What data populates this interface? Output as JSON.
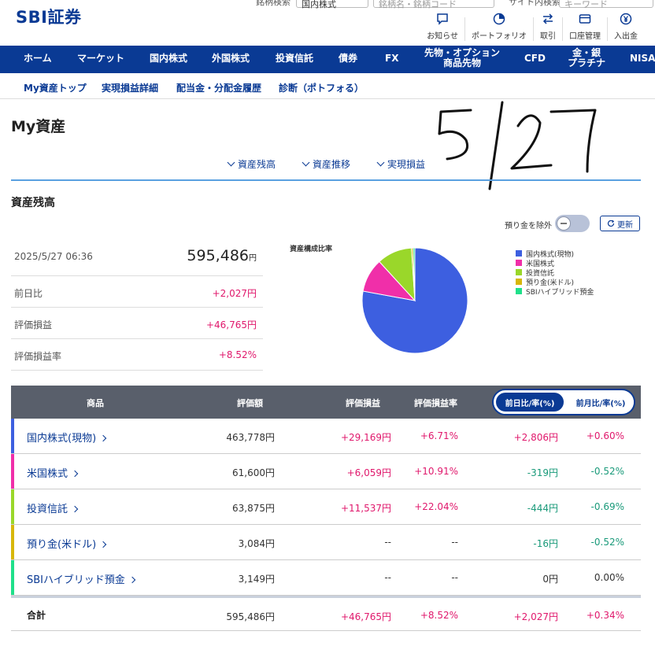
{
  "header": {
    "logo": "SBI証券",
    "search_label_1": "銘柄検索",
    "search_value_1": "国内株式",
    "search_placeholder_2": "銘柄名・銘柄コード",
    "search_label_2": "サイト内検索",
    "search_placeholder_3": "キーワード",
    "util": [
      {
        "label": "お知らせ",
        "icon": "chat-icon"
      },
      {
        "label": "ポートフォリオ",
        "icon": "portfolio-icon"
      },
      {
        "label": "取引",
        "icon": "transfer-icon"
      },
      {
        "label": "口座管理",
        "icon": "card-icon"
      },
      {
        "label": "入出金",
        "icon": "yen-icon"
      }
    ]
  },
  "gnav": [
    {
      "label": "ホーム"
    },
    {
      "label": "マーケット"
    },
    {
      "label": "国内株式"
    },
    {
      "label": "外国株式"
    },
    {
      "label": "投資信託"
    },
    {
      "label": "債券"
    },
    {
      "label": "FX"
    },
    {
      "label": "先物・オプション",
      "label2": "商品先物"
    },
    {
      "label": "CFD"
    },
    {
      "label": "金・銀",
      "label2": "プラチナ"
    },
    {
      "label": "NISA"
    }
  ],
  "subnav": [
    "My資産トップ",
    "実現損益詳細",
    "配当金・分配金履歴",
    "診断（ポトフォる）"
  ],
  "page_title": "My資産",
  "section_links": [
    "資産残高",
    "資産推移",
    "実現損益"
  ],
  "section_title": "資産残高",
  "toggle_label": "預り金を除外",
  "refresh_label": "更新",
  "summary": {
    "datetime": "2025/5/27 06:36",
    "total": "595,486",
    "total_unit": "円",
    "rows": [
      {
        "label": "前日比",
        "value": "+2,027円"
      },
      {
        "label": "評価損益",
        "value": "+46,765円"
      },
      {
        "label": "評価損益率",
        "value": "+8.52%"
      }
    ]
  },
  "chart_data": {
    "type": "pie",
    "title": "資産構成比率",
    "legend_position": "right",
    "labels": [
      "国内株式(現物)",
      "米国株式",
      "投資信託",
      "預り金(米ドル)",
      "SBIハイブリッド預金"
    ],
    "values": [
      463778,
      61600,
      63875,
      3084,
      3149
    ],
    "colors": [
      "#3d5fe0",
      "#f02fa9",
      "#9ad72a",
      "#d7b70a",
      "#1fe08a"
    ]
  },
  "table": {
    "headers": {
      "product": "商品",
      "value": "評価額",
      "pl": "評価損益",
      "pl_rate": "評価損益率"
    },
    "tabs": {
      "active": "前日比/率(%)",
      "inactive": "前月比/率(%)"
    },
    "rows": [
      {
        "name": "国内株式(現物)",
        "value": "463,778円",
        "pl": "+29,169円",
        "pl_rate": "+6.71%",
        "diff": "+2,806円",
        "diff_rate": "+0.60%",
        "color": "#3d5fe0",
        "pl_cls": "pos",
        "diff_cls": "pos"
      },
      {
        "name": "米国株式",
        "value": "61,600円",
        "pl": "+6,059円",
        "pl_rate": "+10.91%",
        "diff": "-319円",
        "diff_rate": "-0.52%",
        "color": "#f02fa9",
        "pl_cls": "pos",
        "diff_cls": "neg"
      },
      {
        "name": "投資信託",
        "value": "63,875円",
        "pl": "+11,537円",
        "pl_rate": "+22.04%",
        "diff": "-444円",
        "diff_rate": "-0.69%",
        "color": "#9ad72a",
        "pl_cls": "pos",
        "diff_cls": "neg"
      },
      {
        "name": "預り金(米ドル)",
        "value": "3,084円",
        "pl": "--",
        "pl_rate": "--",
        "diff": "-16円",
        "diff_rate": "-0.52%",
        "color": "#d7b70a",
        "pl_cls": "neu",
        "diff_cls": "neg"
      },
      {
        "name": "SBIハイブリッド預金",
        "value": "3,149円",
        "pl": "--",
        "pl_rate": "--",
        "diff": "0円",
        "diff_rate": "0.00%",
        "color": "#1fe08a",
        "pl_cls": "neu",
        "diff_cls": "neu"
      }
    ],
    "total": {
      "label": "合計",
      "value": "595,486円",
      "pl": "+46,765円",
      "pl_rate": "+8.52%",
      "diff": "+2,027円",
      "diff_rate": "+0.34%"
    }
  },
  "handwritten_note": "5/27"
}
